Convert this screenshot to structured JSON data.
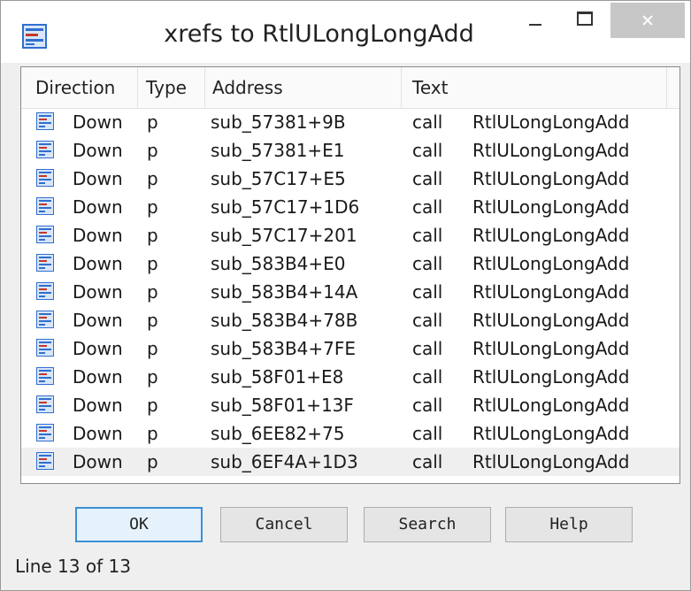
{
  "window": {
    "title": "xrefs to RtlULongLongAdd"
  },
  "list": {
    "columns": [
      "Direction",
      "Type",
      "Address",
      "Text"
    ],
    "rows": [
      {
        "direction": "Down",
        "type": "p",
        "address": "sub_57381+9B",
        "instr": "call",
        "target": "RtlULongLongAdd"
      },
      {
        "direction": "Down",
        "type": "p",
        "address": "sub_57381+E1",
        "instr": "call",
        "target": "RtlULongLongAdd"
      },
      {
        "direction": "Down",
        "type": "p",
        "address": "sub_57C17+E5",
        "instr": "call",
        "target": "RtlULongLongAdd"
      },
      {
        "direction": "Down",
        "type": "p",
        "address": "sub_57C17+1D6",
        "instr": "call",
        "target": "RtlULongLongAdd"
      },
      {
        "direction": "Down",
        "type": "p",
        "address": "sub_57C17+201",
        "instr": "call",
        "target": "RtlULongLongAdd"
      },
      {
        "direction": "Down",
        "type": "p",
        "address": "sub_583B4+E0",
        "instr": "call",
        "target": "RtlULongLongAdd"
      },
      {
        "direction": "Down",
        "type": "p",
        "address": "sub_583B4+14A",
        "instr": "call",
        "target": "RtlULongLongAdd"
      },
      {
        "direction": "Down",
        "type": "p",
        "address": "sub_583B4+78B",
        "instr": "call",
        "target": "RtlULongLongAdd"
      },
      {
        "direction": "Down",
        "type": "p",
        "address": "sub_583B4+7FE",
        "instr": "call",
        "target": "RtlULongLongAdd"
      },
      {
        "direction": "Down",
        "type": "p",
        "address": "sub_58F01+E8",
        "instr": "call",
        "target": "RtlULongLongAdd"
      },
      {
        "direction": "Down",
        "type": "p",
        "address": "sub_58F01+13F",
        "instr": "call",
        "target": "RtlULongLongAdd"
      },
      {
        "direction": "Down",
        "type": "p",
        "address": "sub_6EE82+75",
        "instr": "call",
        "target": "RtlULongLongAdd"
      },
      {
        "direction": "Down",
        "type": "p",
        "address": "sub_6EF4A+1D3",
        "instr": "call",
        "target": "RtlULongLongAdd"
      }
    ],
    "selected_index": 12,
    "row_icon": "xref-icon"
  },
  "buttons": {
    "ok": "OK",
    "cancel": "Cancel",
    "search": "Search",
    "help": "Help"
  },
  "status": "Line 13 of 13",
  "colors": {
    "icon_blue": "#2f6fd0",
    "default_button_border": "#3c8fd6",
    "close_button": "#c7c7c7"
  }
}
